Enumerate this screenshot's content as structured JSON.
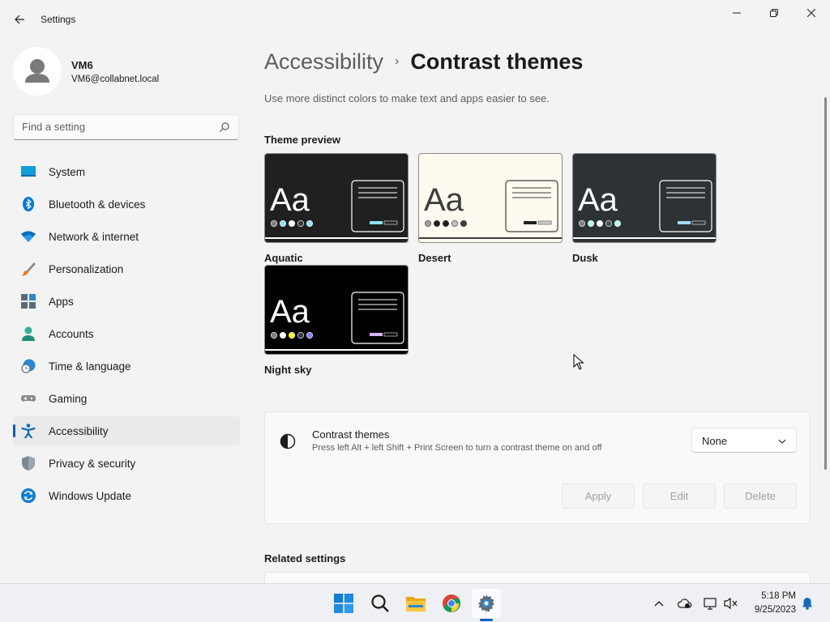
{
  "window": {
    "title": "Settings"
  },
  "user": {
    "name": "VM6",
    "email": "VM6@collabnet.local"
  },
  "search": {
    "placeholder": "Find a setting"
  },
  "nav": [
    {
      "label": "System",
      "icon": "system-icon"
    },
    {
      "label": "Bluetooth & devices",
      "icon": "bluetooth-icon"
    },
    {
      "label": "Network & internet",
      "icon": "wifi-icon"
    },
    {
      "label": "Personalization",
      "icon": "brush-icon"
    },
    {
      "label": "Apps",
      "icon": "apps-icon"
    },
    {
      "label": "Accounts",
      "icon": "person-icon"
    },
    {
      "label": "Time & language",
      "icon": "globe-clock-icon"
    },
    {
      "label": "Gaming",
      "icon": "gamepad-icon"
    },
    {
      "label": "Accessibility",
      "icon": "accessibility-icon",
      "selected": true
    },
    {
      "label": "Privacy & security",
      "icon": "shield-icon"
    },
    {
      "label": "Windows Update",
      "icon": "update-icon"
    }
  ],
  "breadcrumb": {
    "parent": "Accessibility",
    "separator": "›",
    "current": "Contrast themes"
  },
  "page": {
    "description": "Use more distinct colors to make text and apps easier to see.",
    "preview_title": "Theme preview",
    "related_title": "Related settings"
  },
  "themes": [
    {
      "name": "Aquatic",
      "glyph": "Aa",
      "bg": "#202020",
      "text": "#ffffff",
      "line": "#ffffff",
      "dots": [
        "#808080",
        "#8ee3f5",
        "#ffffff",
        "#3a3a3a",
        "#8ee3f5"
      ],
      "btn1": "#8ee3f5",
      "btn2": "#202020"
    },
    {
      "name": "Desert",
      "glyph": "Aa",
      "bg": "#fffaef",
      "text": "#3d3d3d",
      "line": "#3d3d3d",
      "dots": [
        "#a0a0a0",
        "#202020",
        "#202020",
        "#c0c0c0",
        "#3d3d3d"
      ],
      "btn1": "#202020",
      "btn2": "#d0d0d0"
    },
    {
      "name": "Dusk",
      "glyph": "Aa",
      "bg": "#2d3236",
      "text": "#ffffff",
      "line": "#ffffff",
      "dots": [
        "#808080",
        "#b6f6f0",
        "#ffffff",
        "#4a5056",
        "#b6f6f0"
      ],
      "btn1": "#a6d8ff",
      "btn2": "#2d3236"
    },
    {
      "name": "Night sky",
      "glyph": "Aa",
      "bg": "#000000",
      "text": "#ffffff",
      "line": "#ffffff",
      "dots": [
        "#808080",
        "#ffffff",
        "#ffff00",
        "#3a3a3a",
        "#8080ff"
      ],
      "btn1": "#d6b4fd",
      "btn2": "#000000"
    }
  ],
  "contrast": {
    "title": "Contrast themes",
    "description": "Press left Alt + left Shift + Print Screen to turn a contrast theme on and off",
    "selected": "None",
    "apply": "Apply",
    "edit": "Edit",
    "delete": "Delete"
  },
  "taskbar": {
    "time": "5:18 PM",
    "date": "9/25/2023",
    "apps": [
      "start-icon",
      "search-icon",
      "file-explorer-icon",
      "chrome-icon",
      "settings-icon"
    ]
  }
}
